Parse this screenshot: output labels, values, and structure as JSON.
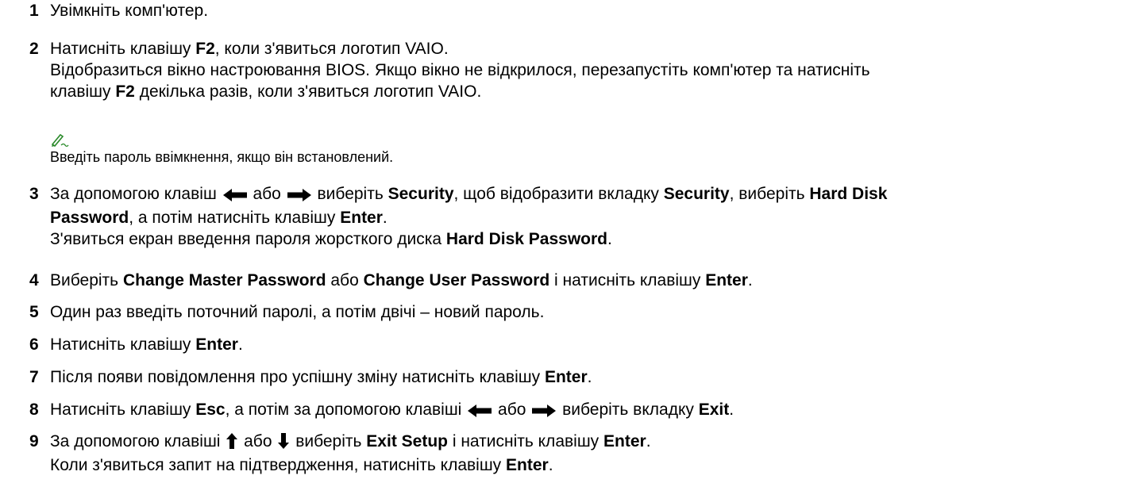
{
  "steps": [
    {
      "number": "1",
      "lines": [
        [
          {
            "t": "Увімкніть комп'ютер."
          }
        ]
      ]
    },
    {
      "number": "2",
      "lines": [
        [
          {
            "t": "Натисніть клавішу "
          },
          {
            "t": "F2",
            "b": true
          },
          {
            "t": ", коли з'явиться логотип VAIO."
          }
        ],
        [
          {
            "t": "Відобразиться вікно настроювання BIOS. Якщо вікно не відкрилося, перезапустіть комп'ютер та натисніть"
          }
        ],
        [
          {
            "t": "клавішу "
          },
          {
            "t": "F2",
            "b": true
          },
          {
            "t": " декілька разів, коли з'явиться логотип VAIO."
          }
        ]
      ],
      "note": {
        "icon": "pencil-note-icon",
        "text": "Введіть пароль ввімкнення, якщо він встановлений."
      }
    },
    {
      "number": "3",
      "lines": [
        [
          {
            "t": "За допомогою клавіш "
          },
          {
            "icon": "arrow-left-icon"
          },
          {
            "t": " або "
          },
          {
            "icon": "arrow-right-icon"
          },
          {
            "t": " виберіть "
          },
          {
            "t": "Security",
            "b": true
          },
          {
            "t": ", щоб відобразити вкладку "
          },
          {
            "t": "Security",
            "b": true
          },
          {
            "t": ", виберіть "
          },
          {
            "t": "Hard Disk",
            "b": true
          }
        ],
        [
          {
            "t": "Password",
            "b": true
          },
          {
            "t": ", а потім натисніть клавішу "
          },
          {
            "t": "Enter",
            "b": true
          },
          {
            "t": "."
          }
        ],
        [
          {
            "t": "З'явиться екран введення пароля жорсткого диска "
          },
          {
            "t": "Hard Disk Password",
            "b": true
          },
          {
            "t": "."
          }
        ]
      ]
    },
    {
      "number": "4",
      "lines": [
        [
          {
            "t": "Виберіть "
          },
          {
            "t": "Change Master Password",
            "b": true
          },
          {
            "t": " або "
          },
          {
            "t": "Change User Password",
            "b": true
          },
          {
            "t": " і натисніть клавішу "
          },
          {
            "t": "Enter",
            "b": true
          },
          {
            "t": "."
          }
        ]
      ]
    },
    {
      "number": "5",
      "lines": [
        [
          {
            "t": "Один раз введіть поточний паролі, а потім двічі – новий пароль."
          }
        ]
      ]
    },
    {
      "number": "6",
      "lines": [
        [
          {
            "t": "Натисніть клавішу "
          },
          {
            "t": "Enter",
            "b": true
          },
          {
            "t": "."
          }
        ]
      ]
    },
    {
      "number": "7",
      "lines": [
        [
          {
            "t": "Після появи повідомлення про успішну зміну натисніть клавішу "
          },
          {
            "t": "Enter",
            "b": true
          },
          {
            "t": "."
          }
        ]
      ]
    },
    {
      "number": "8",
      "lines": [
        [
          {
            "t": "Натисніть клавішу "
          },
          {
            "t": "Esc",
            "b": true
          },
          {
            "t": ", а потім за допомогою клавіші "
          },
          {
            "icon": "arrow-left-icon"
          },
          {
            "t": " або "
          },
          {
            "icon": "arrow-right-icon"
          },
          {
            "t": " виберіть вкладку "
          },
          {
            "t": "Exit",
            "b": true
          },
          {
            "t": "."
          }
        ]
      ]
    },
    {
      "number": "9",
      "lines": [
        [
          {
            "t": "За допомогою клавіші "
          },
          {
            "icon": "arrow-up-icon"
          },
          {
            "t": " або "
          },
          {
            "icon": "arrow-down-icon"
          },
          {
            "t": " виберіть "
          },
          {
            "t": "Exit Setup",
            "b": true
          },
          {
            "t": " і натисніть клавішу "
          },
          {
            "t": "Enter",
            "b": true
          },
          {
            "t": "."
          }
        ],
        [
          {
            "t": "Коли з'явиться запит на підтвердження, натисніть клавішу "
          },
          {
            "t": "Enter",
            "b": true
          },
          {
            "t": "."
          }
        ]
      ]
    }
  ]
}
